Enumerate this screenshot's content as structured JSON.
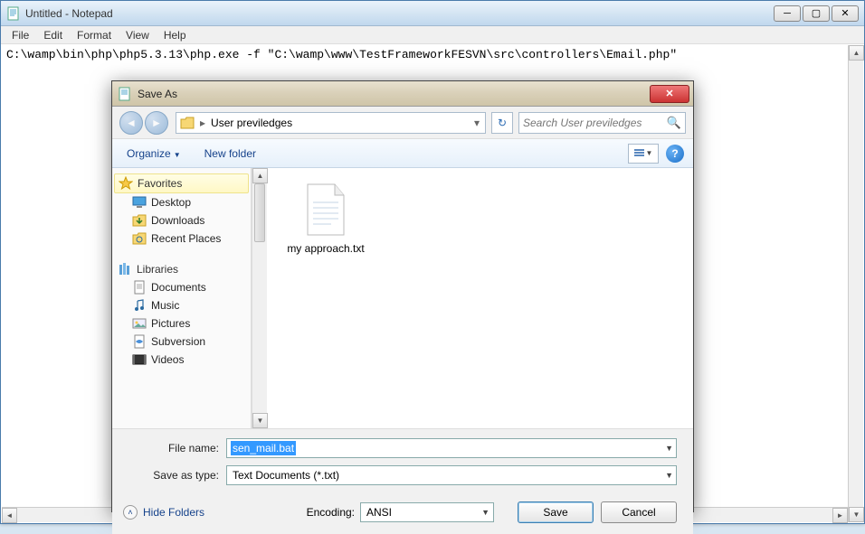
{
  "notepad": {
    "title": "Untitled - Notepad",
    "menus": [
      "File",
      "Edit",
      "Format",
      "View",
      "Help"
    ],
    "content": "C:\\wamp\\bin\\php\\php5.3.13\\php.exe -f \"C:\\wamp\\www\\TestFrameworkFESVN\\src\\controllers\\Email.php\""
  },
  "saveas": {
    "title": "Save As",
    "breadcrumb": {
      "location": "User previledges"
    },
    "search_placeholder": "Search User previledges",
    "toolbar": {
      "organize": "Organize",
      "newfolder": "New folder"
    },
    "nav": {
      "favorites_label": "Favorites",
      "favorites": [
        {
          "icon": "desktop",
          "label": "Desktop"
        },
        {
          "icon": "downloads",
          "label": "Downloads"
        },
        {
          "icon": "recent",
          "label": "Recent Places"
        }
      ],
      "libraries_label": "Libraries",
      "libraries": [
        {
          "icon": "documents",
          "label": "Documents"
        },
        {
          "icon": "music",
          "label": "Music"
        },
        {
          "icon": "pictures",
          "label": "Pictures"
        },
        {
          "icon": "subversion",
          "label": "Subversion"
        },
        {
          "icon": "videos",
          "label": "Videos"
        }
      ]
    },
    "files": [
      {
        "name": "my approach.txt",
        "type": "text"
      }
    ],
    "filename_label": "File name:",
    "filename_value": "sen_mail.bat",
    "savetype_label": "Save as type:",
    "savetype_value": "Text Documents (*.txt)",
    "hide_folders": "Hide Folders",
    "encoding_label": "Encoding:",
    "encoding_value": "ANSI",
    "save_btn": "Save",
    "cancel_btn": "Cancel"
  }
}
